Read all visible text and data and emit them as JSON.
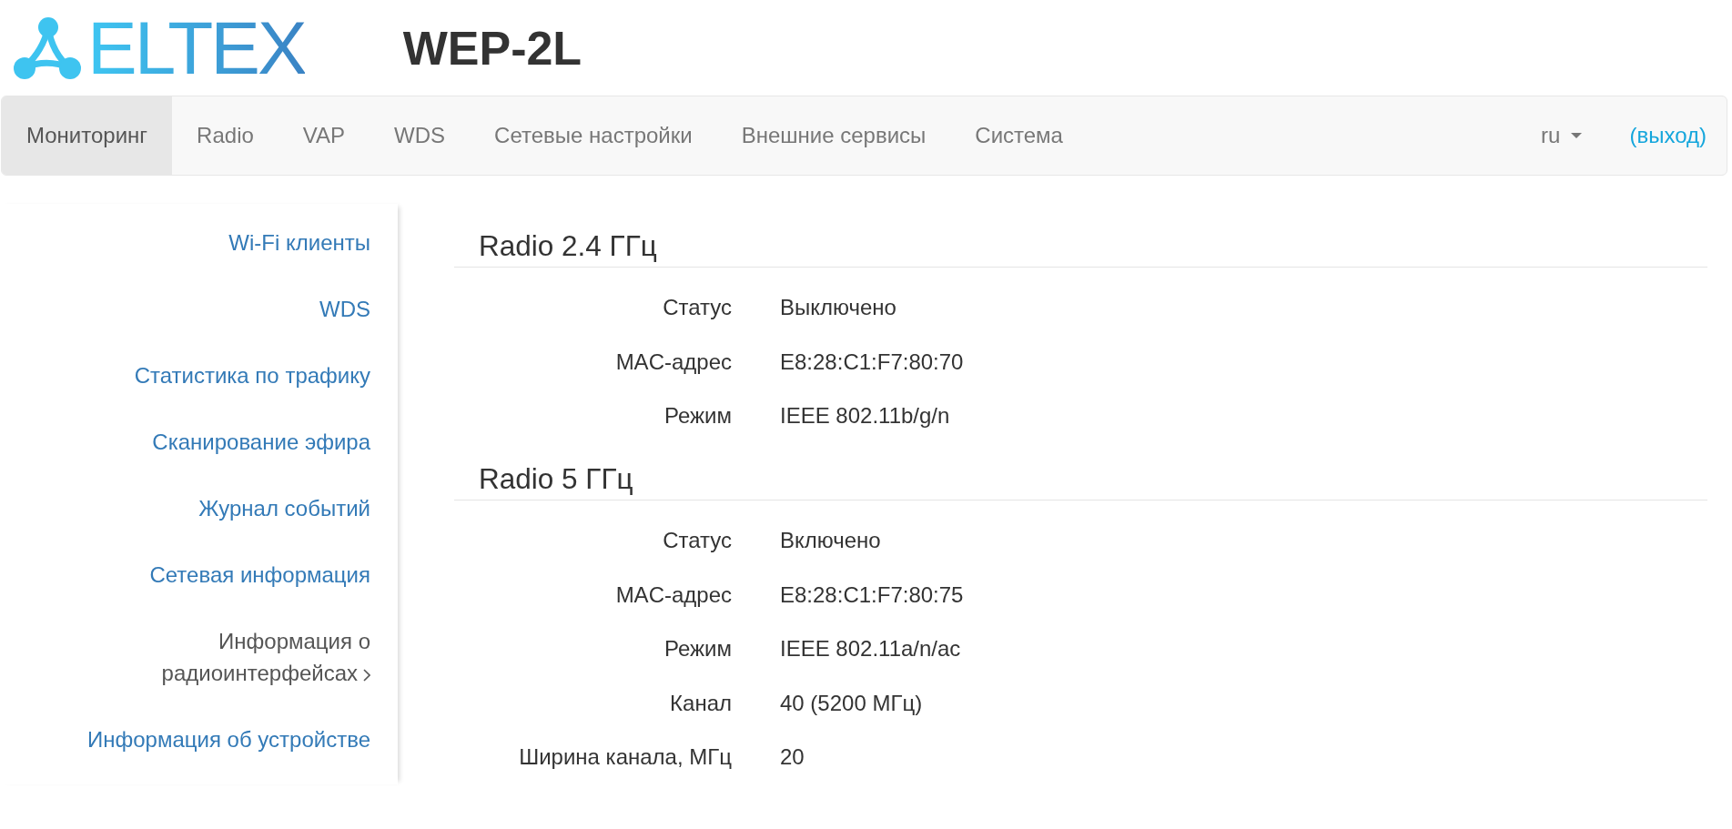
{
  "header": {
    "logo": {
      "text": "ELTEX"
    },
    "device": "WEP-2L"
  },
  "nav": {
    "tabs": [
      {
        "label": "Мониторинг",
        "selected": true
      },
      {
        "label": "Radio",
        "selected": false
      },
      {
        "label": "VAP",
        "selected": false
      },
      {
        "label": "WDS",
        "selected": false
      },
      {
        "label": "Сетевые настройки",
        "selected": false
      },
      {
        "label": "Внешние сервисы",
        "selected": false
      },
      {
        "label": "Система",
        "selected": false
      }
    ],
    "language": "ru",
    "logout": "(выход)"
  },
  "sidebar": {
    "items": [
      {
        "label": "Wi-Fi клиенты",
        "selected": false
      },
      {
        "label": "WDS",
        "selected": false
      },
      {
        "label": "Статистика по трафику",
        "selected": false
      },
      {
        "label": "Сканирование эфира",
        "selected": false
      },
      {
        "label": "Журнал событий",
        "selected": false
      },
      {
        "label": "Сетевая информация",
        "selected": false
      },
      {
        "label": "Информация о радиоинтерфейсах",
        "selected": true
      },
      {
        "label": "Информация об устройстве",
        "selected": false
      }
    ]
  },
  "sections": [
    {
      "title": "Radio 2.4 ГГц",
      "rows": [
        {
          "label": "Статус",
          "value": "Выключено"
        },
        {
          "label": "MAC-адрес",
          "value": "E8:28:C1:F7:80:70"
        },
        {
          "label": "Режим",
          "value": "IEEE 802.11b/g/n"
        }
      ]
    },
    {
      "title": "Radio 5 ГГц",
      "rows": [
        {
          "label": "Статус",
          "value": "Включено"
        },
        {
          "label": "MAC-адрес",
          "value": "E8:28:C1:F7:80:75"
        },
        {
          "label": "Режим",
          "value": "IEEE 802.11a/n/ac"
        },
        {
          "label": "Канал",
          "value": "40 (5200 МГц)"
        },
        {
          "label": "Ширина канала, МГц",
          "value": "20"
        }
      ]
    }
  ]
}
